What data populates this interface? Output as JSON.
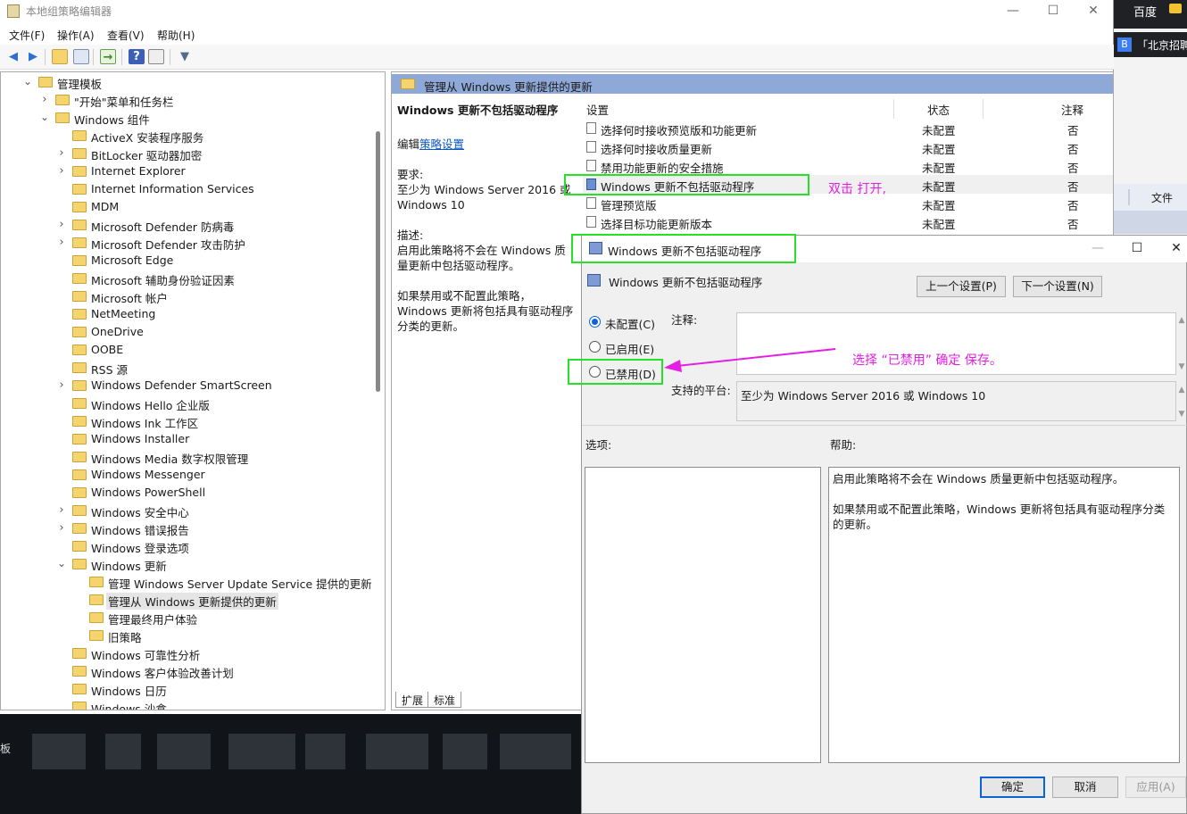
{
  "window": {
    "title": "本地组策略编辑器",
    "controls": {
      "minimize": "—",
      "maximize": "☐",
      "close": "✕"
    }
  },
  "menu": [
    "文件(F)",
    "操作(A)",
    "查看(V)",
    "帮助(H)"
  ],
  "tree": [
    {
      "label": "管理模板",
      "arrow": "expanded"
    },
    {
      "label": "\"开始\"菜单和任务栏",
      "arrow": "collapsed"
    },
    {
      "label": "Windows 组件",
      "arrow": "expanded"
    },
    {
      "label": "ActiveX 安装程序服务",
      "arrow": "none"
    },
    {
      "label": "BitLocker 驱动器加密",
      "arrow": "collapsed"
    },
    {
      "label": "Internet Explorer",
      "arrow": "collapsed"
    },
    {
      "label": "Internet Information Services",
      "arrow": "none"
    },
    {
      "label": "MDM",
      "arrow": "none"
    },
    {
      "label": "Microsoft Defender 防病毒",
      "arrow": "collapsed"
    },
    {
      "label": "Microsoft Defender 攻击防护",
      "arrow": "collapsed"
    },
    {
      "label": "Microsoft Edge",
      "arrow": "none"
    },
    {
      "label": "Microsoft 辅助身份验证因素",
      "arrow": "none"
    },
    {
      "label": "Microsoft 帐户",
      "arrow": "none"
    },
    {
      "label": "NetMeeting",
      "arrow": "none"
    },
    {
      "label": "OneDrive",
      "arrow": "none"
    },
    {
      "label": "OOBE",
      "arrow": "none"
    },
    {
      "label": "RSS 源",
      "arrow": "none"
    },
    {
      "label": "Windows Defender SmartScreen",
      "arrow": "collapsed"
    },
    {
      "label": "Windows Hello 企业版",
      "arrow": "none"
    },
    {
      "label": "Windows Ink 工作区",
      "arrow": "none"
    },
    {
      "label": "Windows Installer",
      "arrow": "none"
    },
    {
      "label": "Windows Media 数字权限管理",
      "arrow": "none"
    },
    {
      "label": "Windows Messenger",
      "arrow": "none"
    },
    {
      "label": "Windows PowerShell",
      "arrow": "none"
    },
    {
      "label": "Windows 安全中心",
      "arrow": "collapsed"
    },
    {
      "label": "Windows 错误报告",
      "arrow": "collapsed"
    },
    {
      "label": "Windows 登录选项",
      "arrow": "none"
    },
    {
      "label": "Windows 更新",
      "arrow": "expanded"
    },
    {
      "label": "管理 Windows Server Update Service 提供的更新",
      "arrow": "none"
    },
    {
      "label": "管理从 Windows 更新提供的更新",
      "arrow": "none",
      "selected": true
    },
    {
      "label": "管理最终用户体验",
      "arrow": "none"
    },
    {
      "label": "旧策略",
      "arrow": "none"
    },
    {
      "label": "Windows 可靠性分析",
      "arrow": "none"
    },
    {
      "label": "Windows 客户体验改善计划",
      "arrow": "none"
    },
    {
      "label": "Windows 日历",
      "arrow": "none"
    },
    {
      "label": "Windows 沙盒",
      "arrow": "none"
    }
  ],
  "pane": {
    "header": "管理从 Windows 更新提供的更新",
    "desc_title": "Windows 更新不包括驱动程序",
    "edit_prefix": "编辑",
    "edit_link": "策略设置",
    "requirement_label": "要求:",
    "requirement_text": "至少为 Windows Server 2016 或 Windows 10",
    "description_label": "描述:",
    "description_text": "启用此策略将不会在 Windows 质量更新中包括驱动程序。",
    "description_text2": "如果禁用或不配置此策略，Windows 更新将包括具有驱动程序分类的更新。",
    "columns": {
      "setting": "设置",
      "state": "状态",
      "comment": "注释"
    },
    "rows": [
      {
        "name": "选择何时接收预览版和功能更新",
        "state": "未配置",
        "comment": "否"
      },
      {
        "name": "选择何时接收质量更新",
        "state": "未配置",
        "comment": "否"
      },
      {
        "name": "禁用功能更新的安全措施",
        "state": "未配置",
        "comment": "否"
      },
      {
        "name": "Windows 更新不包括驱动程序",
        "state": "未配置",
        "comment": "否",
        "highlight": true
      },
      {
        "name": "管理预览版",
        "state": "未配置",
        "comment": "否"
      },
      {
        "name": "选择目标功能更新版本",
        "state": "未配置",
        "comment": "否"
      }
    ],
    "tabs": [
      "扩展",
      "标准"
    ]
  },
  "annotations": {
    "double_click": "双击 打开,",
    "choose": "选择  “已禁用”   确定 保存。"
  },
  "dialog": {
    "title": "Windows 更新不包括驱动程序",
    "subtitle": "Windows 更新不包括驱动程序",
    "prev_button": "上一个设置(P)",
    "next_button": "下一个设置(N)",
    "radio_not_configured": "未配置(C)",
    "radio_enabled": "已启用(E)",
    "radio_disabled": "已禁用(D)",
    "comment_label": "注释:",
    "platform_label": "支持的平台:",
    "platform_value": "至少为 Windows Server 2016 或 Windows 10",
    "options_label": "选项:",
    "help_label": "帮助:",
    "help_text1": "启用此策略将不会在 Windows 质量更新中包括驱动程序。",
    "help_text2": "如果禁用或不配置此策略，Windows 更新将包括具有驱动程序分类的更新。",
    "ok": "确定",
    "cancel": "取消",
    "apply": "应用(A)"
  },
  "browser": {
    "top_text": "百度",
    "tab_text": "「北京招聘",
    "tab_icon": "B",
    "nav_text": "文件"
  },
  "desktop": {
    "side_text": "板"
  }
}
